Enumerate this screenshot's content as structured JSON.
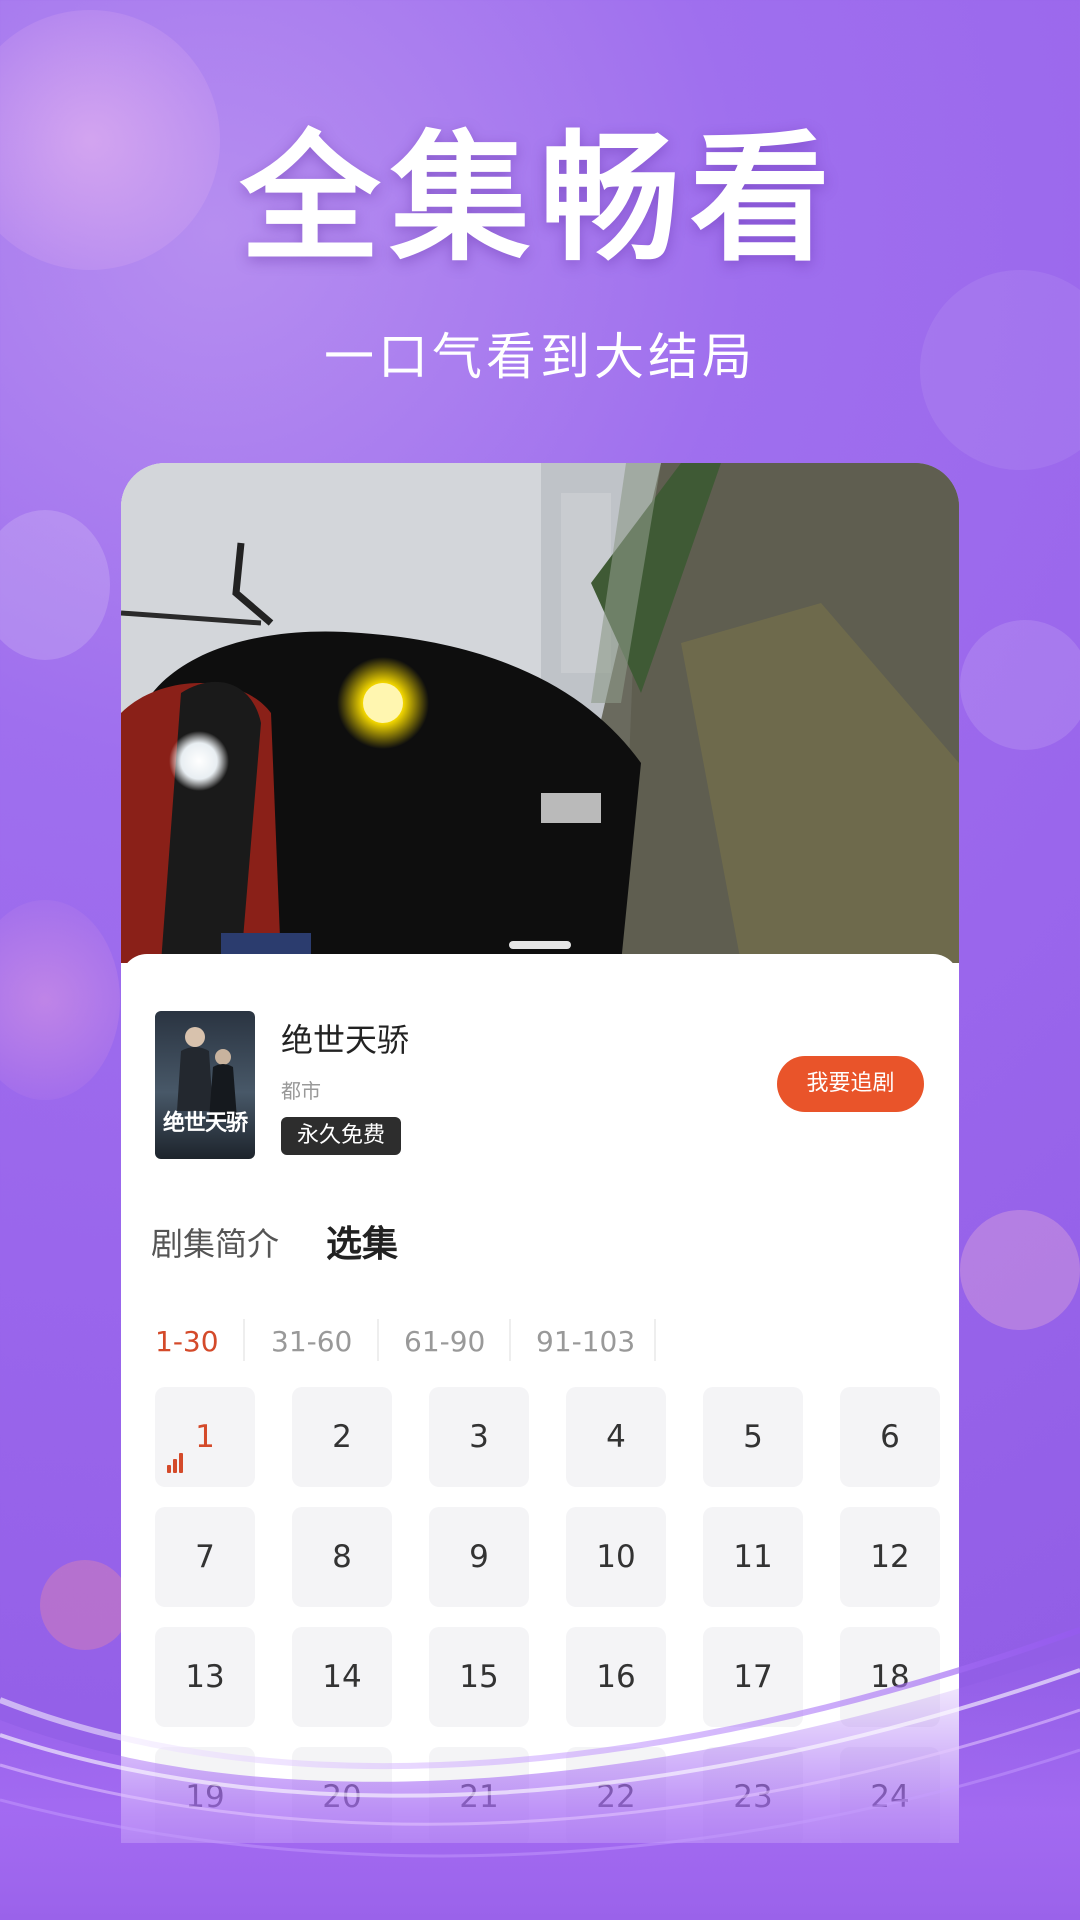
{
  "headline": "全集畅看",
  "subline": "一口气看到大结局",
  "drama": {
    "title": "绝世天骄",
    "genre": "都市",
    "badge": "永久免费",
    "poster_title": "绝世天骄",
    "follow_button": "我要追剧"
  },
  "tabs": {
    "intro": "剧集简介",
    "episodes": "选集"
  },
  "ranges": [
    "1-30",
    "31-60",
    "61-90",
    "91-103"
  ],
  "episodes": [
    "1",
    "2",
    "3",
    "4",
    "5",
    "6",
    "7",
    "8",
    "9",
    "10",
    "11",
    "12",
    "13",
    "14",
    "15",
    "16",
    "17",
    "18",
    "19",
    "20",
    "21",
    "22",
    "23",
    "24"
  ],
  "colors": {
    "background": "#9a66ec",
    "accent": "#e9542a",
    "active_text": "#d44a2a"
  },
  "icons": [
    "playing-icon"
  ]
}
